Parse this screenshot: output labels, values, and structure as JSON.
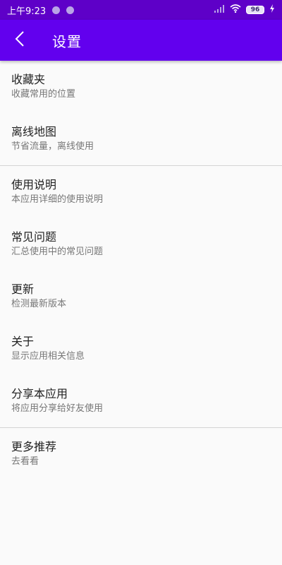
{
  "status_bar": {
    "time": "上午9:23",
    "battery": "96",
    "icons": [
      "notification-dot-icon",
      "notification-dot-icon",
      "signal-icon",
      "wifi-icon",
      "battery-icon",
      "charging-icon"
    ]
  },
  "toolbar": {
    "title": "设置",
    "back_icon": "back-arrow-icon"
  },
  "colors": {
    "status_bar": "#5e00c8",
    "toolbar": "#6200ee",
    "background": "#fafafa",
    "title_text": "#222222",
    "subtitle_text": "#777777",
    "divider": "#d4d4d4"
  },
  "settings": {
    "items": [
      {
        "title": "收藏夹",
        "subtitle": "收藏常用的位置"
      },
      {
        "title": "离线地图",
        "subtitle": "节省流量，离线使用"
      },
      {
        "title": "使用说明",
        "subtitle": "本应用详细的使用说明"
      },
      {
        "title": "常见问题",
        "subtitle": "汇总使用中的常见问题"
      },
      {
        "title": "更新",
        "subtitle": "检测最新版本"
      },
      {
        "title": "关于",
        "subtitle": "显示应用相关信息"
      },
      {
        "title": "分享本应用",
        "subtitle": "将应用分享给好友使用"
      },
      {
        "title": "更多推荐",
        "subtitle": "去看看"
      }
    ]
  }
}
